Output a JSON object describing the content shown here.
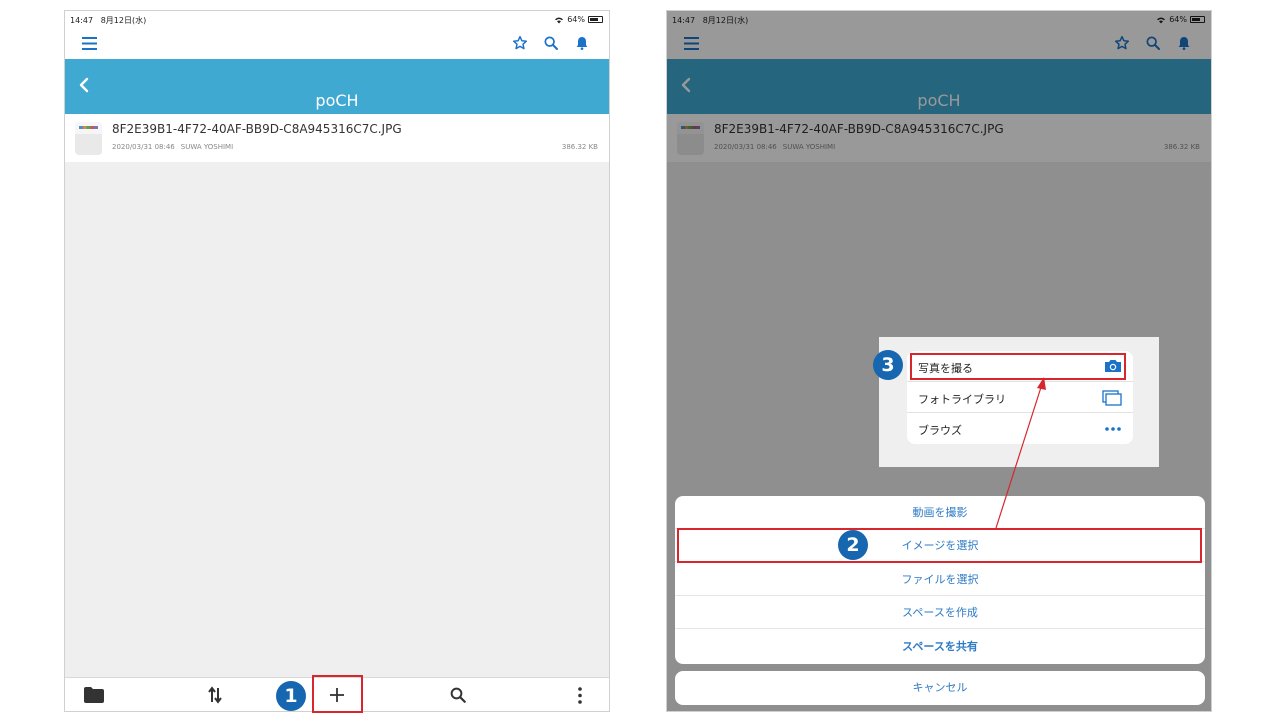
{
  "status_bar": {
    "time": "14:47",
    "date": "8月12日(水)",
    "battery": "64%"
  },
  "icons": {
    "menu": "hamburger-icon",
    "favorites": "star-icon",
    "search": "search-icon",
    "notifications": "bell-icon",
    "back": "chevron-left-icon",
    "folder": "folder-icon",
    "transfer": "sort-arrows-icon",
    "add": "plus-icon",
    "more": "more-vertical-icon",
    "camera": "camera-icon",
    "library": "photo-library-icon",
    "browse": "ellipsis-icon"
  },
  "header": {
    "title": "poCH"
  },
  "file": {
    "name": "8F2E39B1-4F72-40AF-BB9D-C8A945316C7C.JPG",
    "date": "2020/03/31 08:46",
    "owner": "SUWA YOSHIMI",
    "size": "386.32 KB"
  },
  "popover": {
    "items": [
      {
        "label": "写真を撮る"
      },
      {
        "label": "フォトライブラリ"
      },
      {
        "label": "ブラウズ"
      }
    ]
  },
  "sheet": {
    "items": [
      {
        "label": "動画を撮影"
      },
      {
        "label": "イメージを選択"
      },
      {
        "label": "ファイルを選択"
      },
      {
        "label": "スペースを作成"
      },
      {
        "label": "スペースを共有"
      }
    ],
    "cancel": "キャンセル"
  },
  "annotations": {
    "step1": "1",
    "step2": "2",
    "step3": "3"
  },
  "colors": {
    "accent": "#1a73c8",
    "header": "#3fa9d2",
    "highlight": "#d8262c",
    "badge": "#1766b0"
  }
}
